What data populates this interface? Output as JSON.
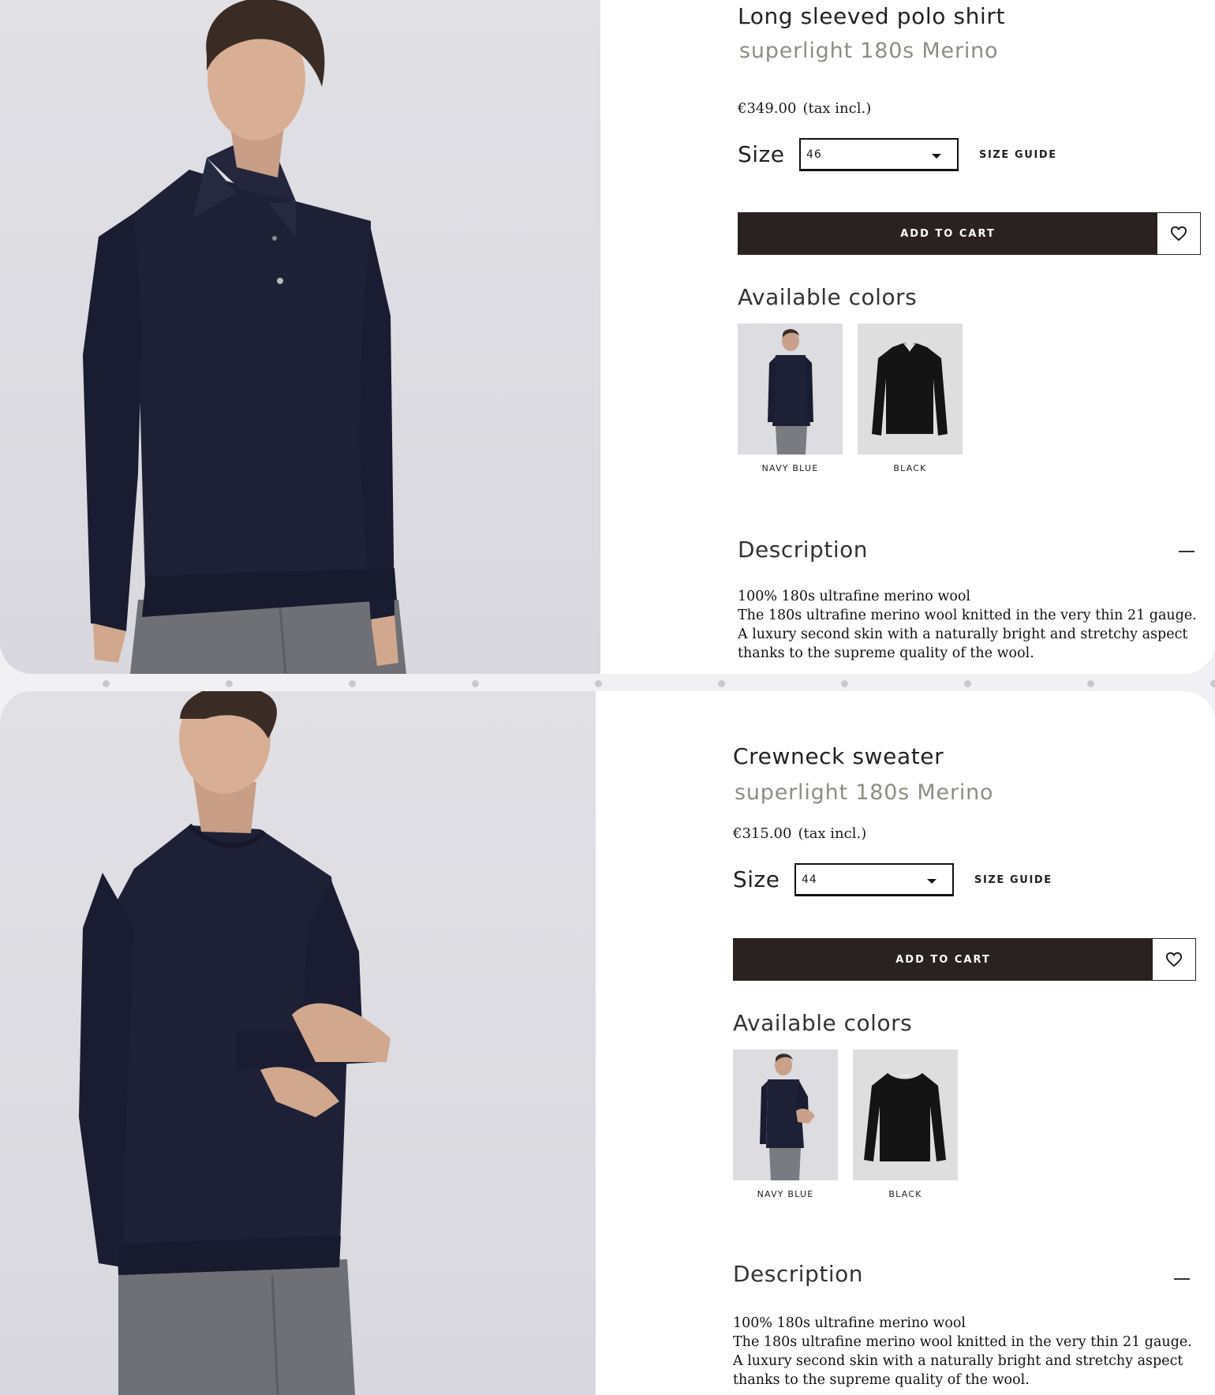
{
  "products": [
    {
      "title": "Long sleeved polo shirt",
      "subtitle": "superlight 180s Merino",
      "price": "€349.00",
      "tax_note": "(tax incl.)",
      "size_label": "Size",
      "size_value": "46",
      "size_guide": "SIZE GUIDE",
      "add_to_cart": "ADD TO CART",
      "colors_title": "Available colors",
      "colors": [
        {
          "label": "NAVY BLUE"
        },
        {
          "label": "BLACK"
        }
      ],
      "description_title": "Description",
      "description_line1": "100% 180s ultrafine merino wool",
      "description_body": "The 180s ultrafine merino wool knitted in the very thin 21 gauge. A luxury second skin with a naturally bright and stretchy aspect thanks to the supreme quality of the wool."
    },
    {
      "title": "Crewneck sweater",
      "subtitle": "superlight 180s Merino",
      "price": "€315.00",
      "tax_note": "(tax incl.)",
      "size_label": "Size",
      "size_value": "44",
      "size_guide": "SIZE GUIDE",
      "add_to_cart": "ADD TO CART",
      "colors_title": "Available colors",
      "colors": [
        {
          "label": "NAVY BLUE"
        },
        {
          "label": "BLACK"
        }
      ],
      "description_title": "Description",
      "description_line1": "100% 180s ultrafine merino wool",
      "description_body": "The 180s ultrafine merino wool knitted in the very thin 21 gauge. A luxury second skin with a naturally bright and stretchy aspect thanks to the supreme quality of the wool."
    }
  ],
  "icons": {
    "wishlist": "heart-icon",
    "size_caret": "caret-down-icon",
    "collapse": "minus-icon"
  },
  "colors": {
    "button_bg": "#2a2220",
    "subtitle": "#8f8d84",
    "garment_navy": "#1c1f33",
    "garment_black": "#141414",
    "photo_bg": "#dcdce1"
  }
}
